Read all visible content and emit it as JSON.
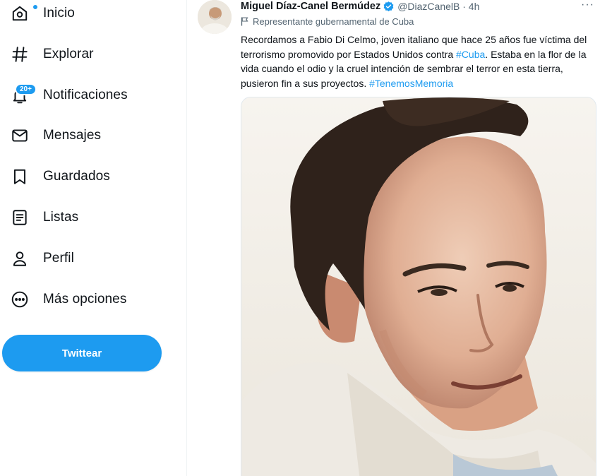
{
  "nav": {
    "items": [
      {
        "label": "Inicio",
        "icon": "home-icon"
      },
      {
        "label": "Explorar",
        "icon": "hashtag-icon"
      },
      {
        "label": "Notificaciones",
        "icon": "bell-icon",
        "badge": "20+"
      },
      {
        "label": "Mensajes",
        "icon": "envelope-icon"
      },
      {
        "label": "Guardados",
        "icon": "bookmark-icon"
      },
      {
        "label": "Listas",
        "icon": "list-icon"
      },
      {
        "label": "Perfil",
        "icon": "person-icon"
      },
      {
        "label": "Más opciones",
        "icon": "more-circle-icon"
      }
    ],
    "tweet_button": "Twittear"
  },
  "tweet": {
    "author": "Miguel Díaz-Canel Bermúdez",
    "handle": "@DiazCanelB · 4h",
    "more": "···",
    "gov_label": "Representante gubernamental de Cuba",
    "text": {
      "part1": "Recordamos a Fabio Di Celmo, joven italiano que hace 25 años fue víctima del terrorismo promovido por Estados Unidos contra ",
      "hashtag1": "#Cuba",
      "part2": ". Estaba en la flor de la vida cuando el odio y la cruel intención de sembrar el terror en esta tierra, pusieron fin a sus proyectos. ",
      "hashtag2": "#TenemosMemoria"
    }
  },
  "colors": {
    "accent": "#1d9bf0",
    "text": "#0f1419",
    "secondary": "#536471"
  }
}
